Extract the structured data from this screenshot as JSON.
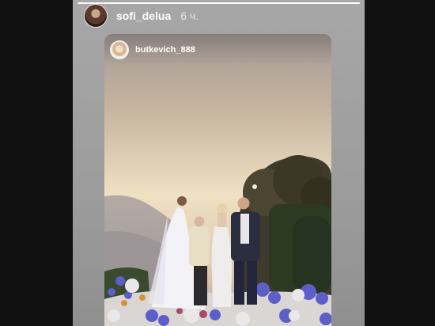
{
  "story": {
    "progress_fraction": 1,
    "author": {
      "username": "sofi_delua",
      "time_ago": "6 ч."
    },
    "repost": {
      "username": "butkevich_888"
    }
  },
  "icons": {
    "author_avatar": "profile-photo",
    "repost_avatar": "profile-photo"
  },
  "colors": {
    "sky_top": "#efe1c3",
    "sky_bottom": "#b3aca7",
    "dress": "#f3f2f7",
    "hydrangea": "#5d5fc9"
  }
}
